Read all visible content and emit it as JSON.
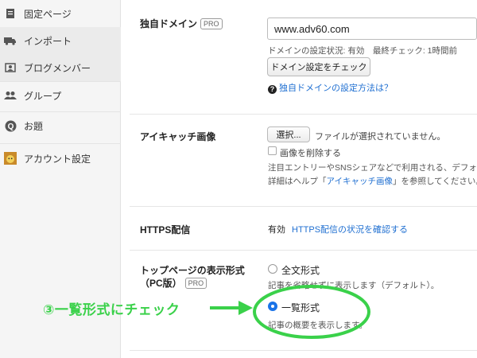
{
  "sidebar": {
    "items": [
      {
        "label": "固定ページ",
        "icon": "page-icon"
      },
      {
        "label": "インポート",
        "icon": "truck-icon"
      },
      {
        "label": "ブログメンバー",
        "icon": "member-card-icon"
      },
      {
        "label": "グループ",
        "icon": "group-icon"
      },
      {
        "label": "お題",
        "icon": "odai-icon"
      },
      {
        "label": "アカウント設定",
        "icon": "account-avatar-icon"
      }
    ]
  },
  "domain": {
    "label": "独自ドメイン",
    "pro": "PRO",
    "value": "www.adv60.com",
    "status": "ドメインの設定状況: 有効　最終チェック: 1時間前",
    "check_button": "ドメイン設定をチェック",
    "help_link": "独自ドメインの設定方法は？"
  },
  "eyecatch": {
    "label": "アイキャッチ画像",
    "choose_button": "選択...",
    "no_file": "ファイルが選択されていません。",
    "delete_label": "画像を削除する",
    "note1": "注目エントリーやSNSシェアなどで利用される、デフォル",
    "note2_prefix": "詳細はヘルプ「",
    "note2_link": "アイキャッチ画像",
    "note2_suffix": "」を参照してください。"
  },
  "https": {
    "label": "HTTPS配信",
    "status": "有効",
    "link": "HTTPS配信の状況を確認する"
  },
  "toppage": {
    "label_line1": "トップページの表示形式",
    "label_line2": "（PC版）",
    "pro": "PRO",
    "options": [
      {
        "label": "全文形式",
        "desc": "記事を省略せずに表示します（デフォルト）。",
        "selected": false
      },
      {
        "label": "一覧形式",
        "desc": "記事の概要を表示します。",
        "selected": true
      }
    ]
  },
  "annotation": {
    "text": "③一覧形式にチェック",
    "color": "#3ad14a"
  }
}
